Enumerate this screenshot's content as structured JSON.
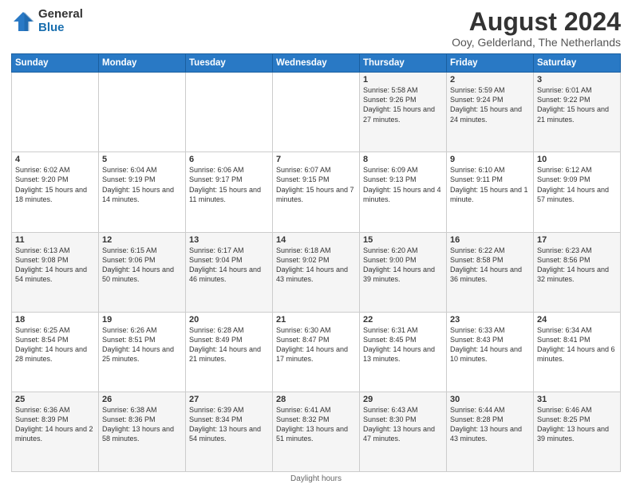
{
  "logo": {
    "general": "General",
    "blue": "Blue"
  },
  "title": "August 2024",
  "subtitle": "Ooy, Gelderland, The Netherlands",
  "headers": [
    "Sunday",
    "Monday",
    "Tuesday",
    "Wednesday",
    "Thursday",
    "Friday",
    "Saturday"
  ],
  "footer": "Daylight hours",
  "weeks": [
    [
      {
        "day": "",
        "info": ""
      },
      {
        "day": "",
        "info": ""
      },
      {
        "day": "",
        "info": ""
      },
      {
        "day": "",
        "info": ""
      },
      {
        "day": "1",
        "info": "Sunrise: 5:58 AM\nSunset: 9:26 PM\nDaylight: 15 hours\nand 27 minutes."
      },
      {
        "day": "2",
        "info": "Sunrise: 5:59 AM\nSunset: 9:24 PM\nDaylight: 15 hours\nand 24 minutes."
      },
      {
        "day": "3",
        "info": "Sunrise: 6:01 AM\nSunset: 9:22 PM\nDaylight: 15 hours\nand 21 minutes."
      }
    ],
    [
      {
        "day": "4",
        "info": "Sunrise: 6:02 AM\nSunset: 9:20 PM\nDaylight: 15 hours\nand 18 minutes."
      },
      {
        "day": "5",
        "info": "Sunrise: 6:04 AM\nSunset: 9:19 PM\nDaylight: 15 hours\nand 14 minutes."
      },
      {
        "day": "6",
        "info": "Sunrise: 6:06 AM\nSunset: 9:17 PM\nDaylight: 15 hours\nand 11 minutes."
      },
      {
        "day": "7",
        "info": "Sunrise: 6:07 AM\nSunset: 9:15 PM\nDaylight: 15 hours\nand 7 minutes."
      },
      {
        "day": "8",
        "info": "Sunrise: 6:09 AM\nSunset: 9:13 PM\nDaylight: 15 hours\nand 4 minutes."
      },
      {
        "day": "9",
        "info": "Sunrise: 6:10 AM\nSunset: 9:11 PM\nDaylight: 15 hours\nand 1 minute."
      },
      {
        "day": "10",
        "info": "Sunrise: 6:12 AM\nSunset: 9:09 PM\nDaylight: 14 hours\nand 57 minutes."
      }
    ],
    [
      {
        "day": "11",
        "info": "Sunrise: 6:13 AM\nSunset: 9:08 PM\nDaylight: 14 hours\nand 54 minutes."
      },
      {
        "day": "12",
        "info": "Sunrise: 6:15 AM\nSunset: 9:06 PM\nDaylight: 14 hours\nand 50 minutes."
      },
      {
        "day": "13",
        "info": "Sunrise: 6:17 AM\nSunset: 9:04 PM\nDaylight: 14 hours\nand 46 minutes."
      },
      {
        "day": "14",
        "info": "Sunrise: 6:18 AM\nSunset: 9:02 PM\nDaylight: 14 hours\nand 43 minutes."
      },
      {
        "day": "15",
        "info": "Sunrise: 6:20 AM\nSunset: 9:00 PM\nDaylight: 14 hours\nand 39 minutes."
      },
      {
        "day": "16",
        "info": "Sunrise: 6:22 AM\nSunset: 8:58 PM\nDaylight: 14 hours\nand 36 minutes."
      },
      {
        "day": "17",
        "info": "Sunrise: 6:23 AM\nSunset: 8:56 PM\nDaylight: 14 hours\nand 32 minutes."
      }
    ],
    [
      {
        "day": "18",
        "info": "Sunrise: 6:25 AM\nSunset: 8:54 PM\nDaylight: 14 hours\nand 28 minutes."
      },
      {
        "day": "19",
        "info": "Sunrise: 6:26 AM\nSunset: 8:51 PM\nDaylight: 14 hours\nand 25 minutes."
      },
      {
        "day": "20",
        "info": "Sunrise: 6:28 AM\nSunset: 8:49 PM\nDaylight: 14 hours\nand 21 minutes."
      },
      {
        "day": "21",
        "info": "Sunrise: 6:30 AM\nSunset: 8:47 PM\nDaylight: 14 hours\nand 17 minutes."
      },
      {
        "day": "22",
        "info": "Sunrise: 6:31 AM\nSunset: 8:45 PM\nDaylight: 14 hours\nand 13 minutes."
      },
      {
        "day": "23",
        "info": "Sunrise: 6:33 AM\nSunset: 8:43 PM\nDaylight: 14 hours\nand 10 minutes."
      },
      {
        "day": "24",
        "info": "Sunrise: 6:34 AM\nSunset: 8:41 PM\nDaylight: 14 hours\nand 6 minutes."
      }
    ],
    [
      {
        "day": "25",
        "info": "Sunrise: 6:36 AM\nSunset: 8:39 PM\nDaylight: 14 hours\nand 2 minutes."
      },
      {
        "day": "26",
        "info": "Sunrise: 6:38 AM\nSunset: 8:36 PM\nDaylight: 13 hours\nand 58 minutes."
      },
      {
        "day": "27",
        "info": "Sunrise: 6:39 AM\nSunset: 8:34 PM\nDaylight: 13 hours\nand 54 minutes."
      },
      {
        "day": "28",
        "info": "Sunrise: 6:41 AM\nSunset: 8:32 PM\nDaylight: 13 hours\nand 51 minutes."
      },
      {
        "day": "29",
        "info": "Sunrise: 6:43 AM\nSunset: 8:30 PM\nDaylight: 13 hours\nand 47 minutes."
      },
      {
        "day": "30",
        "info": "Sunrise: 6:44 AM\nSunset: 8:28 PM\nDaylight: 13 hours\nand 43 minutes."
      },
      {
        "day": "31",
        "info": "Sunrise: 6:46 AM\nSunset: 8:25 PM\nDaylight: 13 hours\nand 39 minutes."
      }
    ]
  ]
}
